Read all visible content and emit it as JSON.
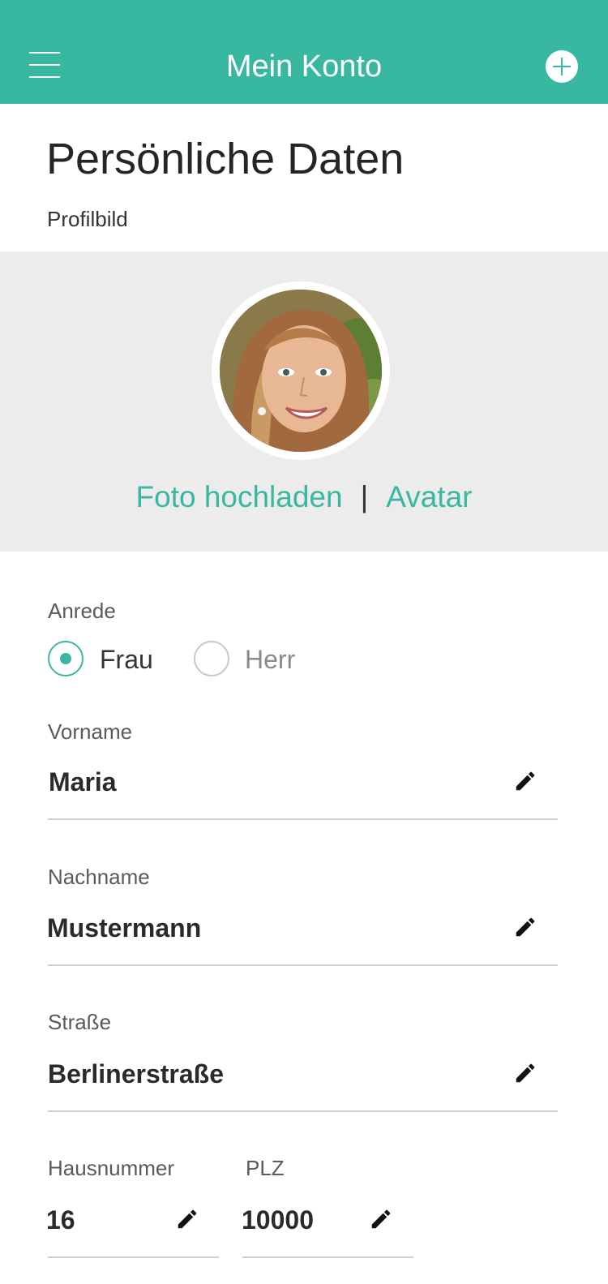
{
  "header": {
    "title": "Mein Konto",
    "menu_icon": "hamburger-menu-icon",
    "add_icon": "plus-circle-icon",
    "background_color": "#38b8a0"
  },
  "page": {
    "title": "Persönliche Daten",
    "profile_label": "Profilbild"
  },
  "photo": {
    "upload_label": "Foto hochladen",
    "separator": "|",
    "avatar_label": "Avatar"
  },
  "salutation": {
    "label": "Anrede",
    "options": [
      {
        "label": "Frau",
        "selected": true
      },
      {
        "label": "Herr",
        "selected": false
      }
    ]
  },
  "fields": {
    "vorname": {
      "label": "Vorname",
      "value": "Maria"
    },
    "nachname": {
      "label": "Nachname",
      "value": "Mustermann"
    },
    "strasse": {
      "label": "Straße",
      "value": "Berlinerstraße"
    },
    "hausnummer": {
      "label": "Hausnummer",
      "value": "16"
    },
    "plz": {
      "label": "PLZ",
      "value": "10000"
    }
  },
  "icons": {
    "edit": "pencil-icon"
  },
  "colors": {
    "accent": "#38b8a0",
    "photo_background": "#ececec"
  }
}
